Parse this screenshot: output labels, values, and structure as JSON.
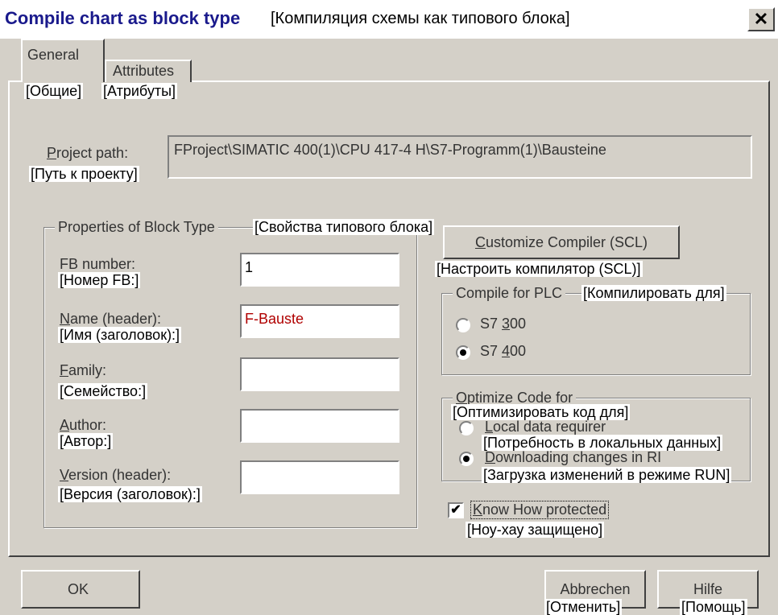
{
  "dialog": {
    "title": "Compile chart as block type",
    "title_ru": "[Компиляция схемы как типового блока]",
    "close_glyph": "✕"
  },
  "tabs": [
    {
      "label": "General",
      "label_ru": "[Общие]"
    },
    {
      "label": "Attributes",
      "label_ru": "[Атрибуты]"
    }
  ],
  "project_path": {
    "label_first": "P",
    "label_rest": "roject path:",
    "label_ru": "[Путь к проекту]",
    "value": "FProject\\SIMATIC 400(1)\\CPU 417-4 H\\S7-Programm(1)\\Bausteine"
  },
  "properties": {
    "legend": "Properties of Block Type",
    "legend_ru": "[Свойства типового блока]",
    "fb_number": {
      "label": "FB number:",
      "label_ru": "[Номер FB:]",
      "value": "1"
    },
    "name": {
      "label_first": "N",
      "label_rest": "ame (header):",
      "label_ru": "[Имя (заголовок):]",
      "value": "F-Bauste"
    },
    "family": {
      "label_first": "F",
      "label_rest": "amily:",
      "label_ru": "[Семейство:]",
      "value": ""
    },
    "author": {
      "label_first": "A",
      "label_rest": "uthor:",
      "label_ru": "[Автор:]",
      "value": ""
    },
    "version": {
      "label_first": "V",
      "label_rest": "ersion (header):",
      "label_ru": "[Версия (заголовок):]",
      "value": ""
    }
  },
  "customize": {
    "label_first": "C",
    "label_rest": "ustomize Compiler (SCL)",
    "label_ru": "[Настроить компилятор (SCL)]"
  },
  "compile_for": {
    "legend": "Compile for PLC",
    "legend_ru": "[Компилировать для]",
    "options": [
      {
        "pre": "S7 ",
        "ul": "3",
        "post": "00",
        "selected": false
      },
      {
        "pre": "S7 ",
        "ul": "4",
        "post": "00",
        "selected": true
      }
    ]
  },
  "optimize": {
    "legend_first": "O",
    "legend_rest": "ptimize Code for",
    "legend_ru": "[Оптимизировать код для]",
    "options": [
      {
        "first": "L",
        "rest": "ocal data requirer",
        "ru": "[Потребность в локальных данных]",
        "selected": false
      },
      {
        "first": "D",
        "rest": "ownloading changes in RI",
        "ru": "[Загрузка изменений в режиме RUN]",
        "selected": true
      }
    ]
  },
  "know_how": {
    "label_first": "K",
    "label_rest": "now How protected",
    "label_ru": "[Ноу-хау защищено]",
    "checked": true,
    "check_glyph": "✔"
  },
  "buttons": {
    "ok": "OK",
    "cancel": "Abbrechen",
    "cancel_ru": "[Отменить]",
    "help": "Hilfe",
    "help_ru": "[Помощь]"
  }
}
